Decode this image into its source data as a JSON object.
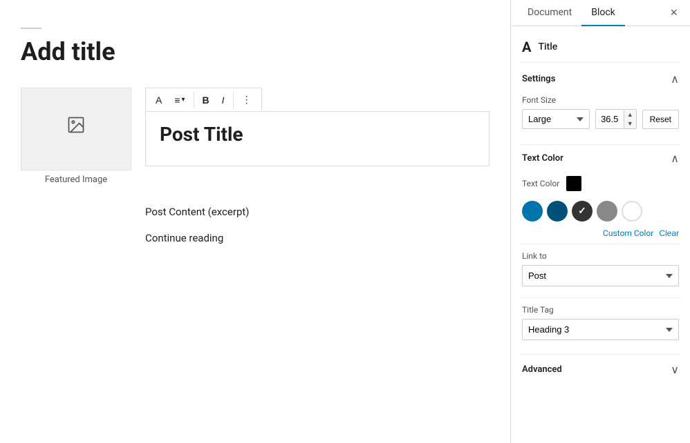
{
  "editor": {
    "add_title_placeholder": "Add title",
    "title_line": "",
    "post_title": "Post Title",
    "post_content": "Post Content (excerpt)",
    "continue_reading": "Continue reading",
    "featured_image_label": "Featured Image"
  },
  "toolbar": {
    "text_btn": "A",
    "align_btn": "≡",
    "bold_btn": "B",
    "italic_btn": "I",
    "more_btn": "⋮"
  },
  "sidebar": {
    "document_tab": "Document",
    "block_tab": "Block",
    "close_label": "×",
    "block_type_icon": "A",
    "block_type_label": "Title",
    "settings_section": "Settings",
    "font_size_label": "Font Size",
    "font_size_value": "36.5",
    "font_size_option": "Large",
    "reset_label": "Reset",
    "text_color_section": "Text Color",
    "text_color_label": "Text Color",
    "custom_color_label": "Custom Color",
    "clear_label": "Clear",
    "link_to_section": "Link to",
    "link_to_option": "Post",
    "title_tag_section": "Title Tag",
    "title_tag_option": "Heading 3",
    "advanced_section": "Advanced",
    "colors": [
      {
        "hex": "#0073aa",
        "label": "Blue",
        "selected": false
      },
      {
        "hex": "#005177",
        "label": "Dark Blue",
        "selected": false
      },
      {
        "hex": "#333333",
        "label": "Dark Gray",
        "selected": true
      },
      {
        "hex": "#888888",
        "label": "Gray",
        "selected": false
      },
      {
        "hex": "#ffffff",
        "label": "White",
        "selected": false
      }
    ]
  }
}
